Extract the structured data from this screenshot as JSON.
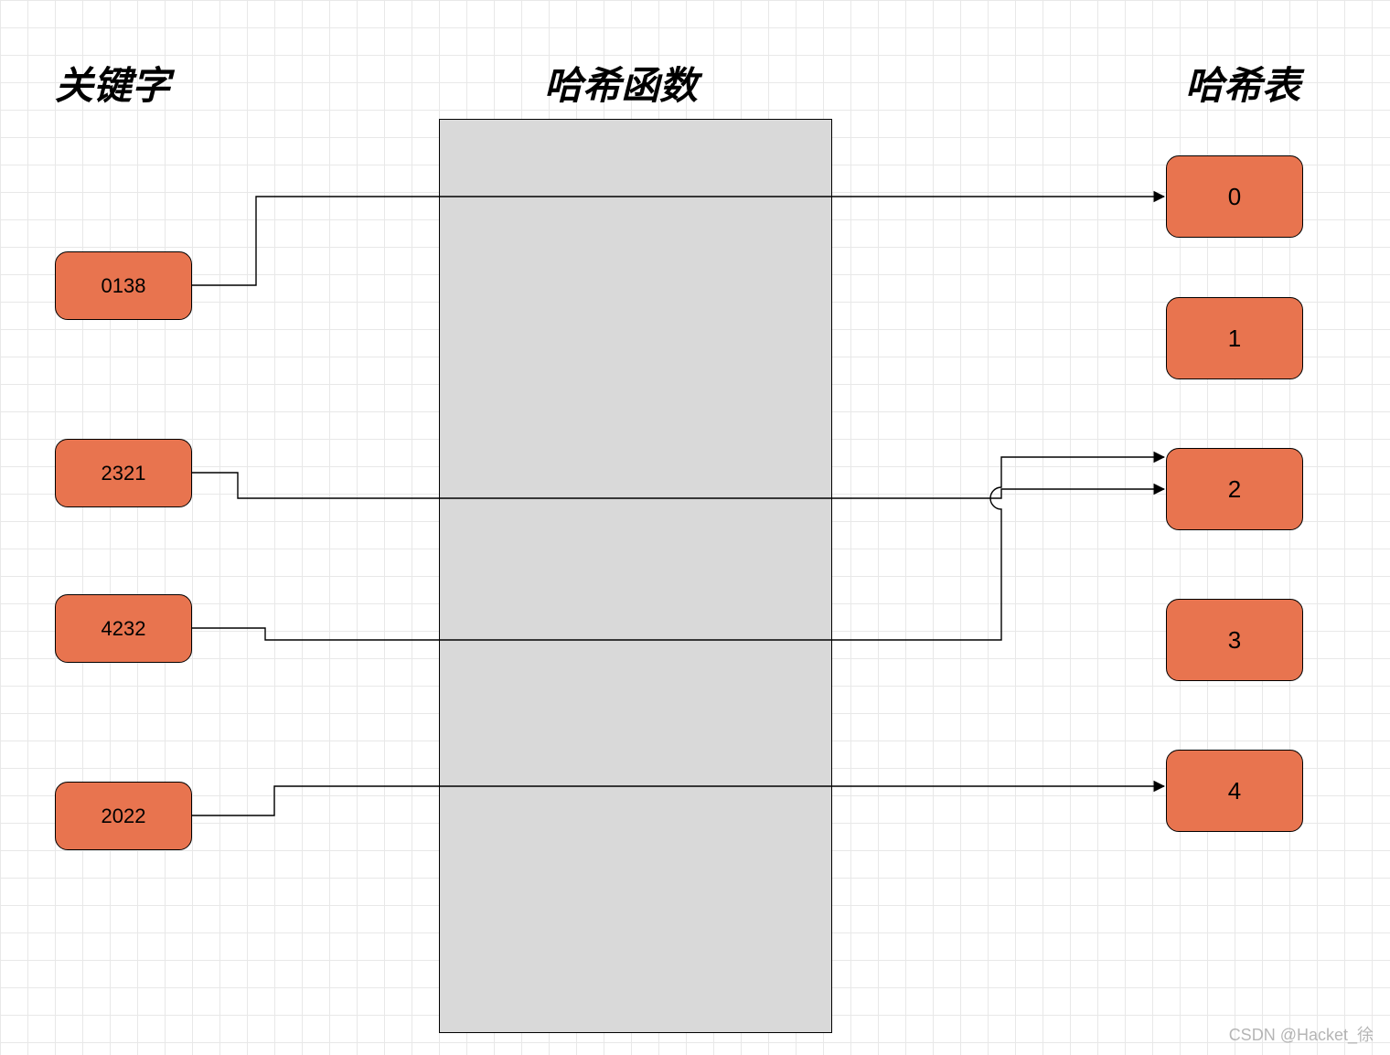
{
  "headings": {
    "keys": "关键字",
    "func": "哈希函数",
    "table": "哈希表"
  },
  "keys": [
    {
      "label": "0138"
    },
    {
      "label": "2321"
    },
    {
      "label": "4232"
    },
    {
      "label": "2022"
    }
  ],
  "hash_table": [
    {
      "label": "0"
    },
    {
      "label": "1"
    },
    {
      "label": "2"
    },
    {
      "label": "3"
    },
    {
      "label": "4"
    }
  ],
  "mappings": [
    {
      "from_key": "0138",
      "to_slot": "0"
    },
    {
      "from_key": "2321",
      "to_slot": "2"
    },
    {
      "from_key": "4232",
      "to_slot": "2"
    },
    {
      "from_key": "2022",
      "to_slot": "4"
    }
  ],
  "colors": {
    "node_fill": "#E8744F",
    "func_fill": "#d9d9d9",
    "grid": "#e8e8e8"
  },
  "watermark": "CSDN @Hacket_徐"
}
